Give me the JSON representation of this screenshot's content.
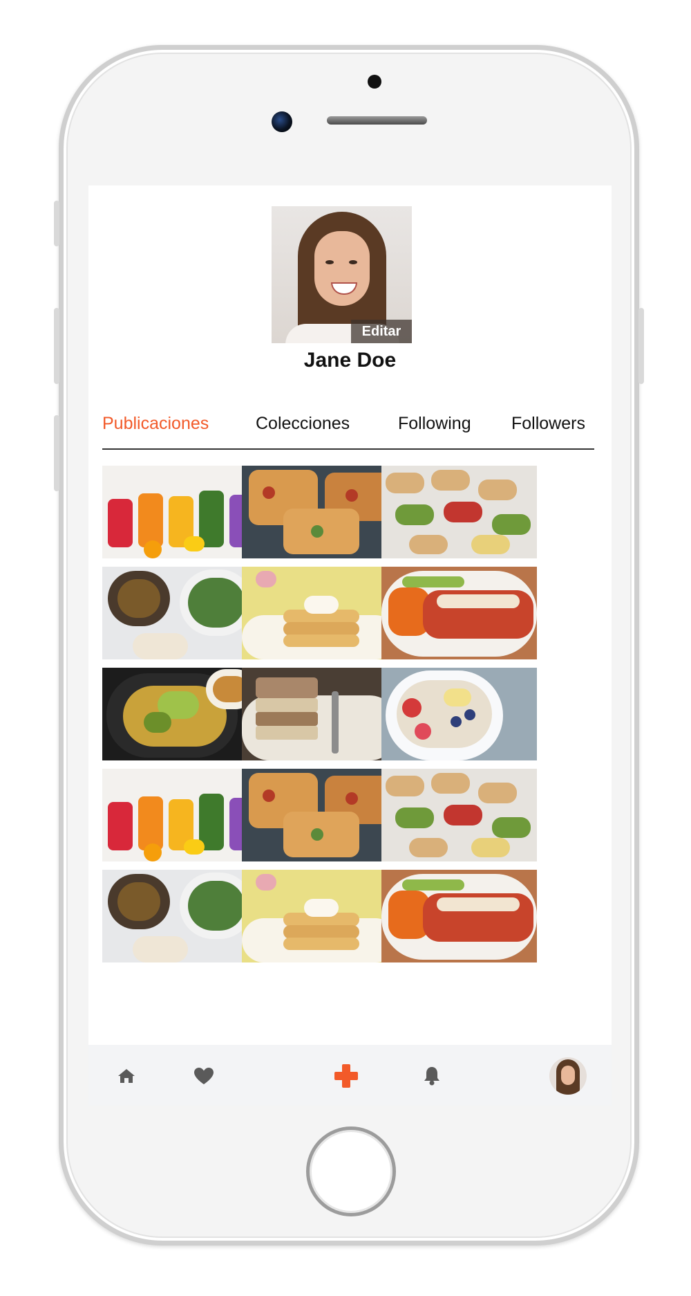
{
  "profile": {
    "name": "Jane Doe",
    "edit_label": "Editar"
  },
  "tabs": [
    {
      "label": "Publicaciones",
      "active": true
    },
    {
      "label": "Colecciones",
      "active": false
    },
    {
      "label": "Following",
      "active": false
    },
    {
      "label": "Followers",
      "active": false
    }
  ],
  "posts": [
    {
      "image": "smoothies-jars"
    },
    {
      "image": "pizza-slices"
    },
    {
      "image": "bruschetta-toasts"
    },
    {
      "image": "salad-bowls"
    },
    {
      "image": "pancakes-stack"
    },
    {
      "image": "enchiladas-plate"
    },
    {
      "image": "avocado-nachos"
    },
    {
      "image": "layer-cake-slice"
    },
    {
      "image": "oatmeal-berries"
    },
    {
      "image": "smoothies-jars"
    },
    {
      "image": "pizza-slices"
    },
    {
      "image": "bruschetta-toasts"
    },
    {
      "image": "salad-bowls"
    },
    {
      "image": "pancakes-stack"
    },
    {
      "image": "enchiladas-plate"
    }
  ],
  "bottom_nav": [
    {
      "icon": "home-icon"
    },
    {
      "icon": "heart-icon"
    },
    {
      "icon": "plus-icon"
    },
    {
      "icon": "bell-icon"
    },
    {
      "icon": "avatar"
    }
  ],
  "colors": {
    "accent": "#f25a29",
    "nav_icon": "#5a5a5a",
    "nav_bg": "#f3f4f6"
  }
}
